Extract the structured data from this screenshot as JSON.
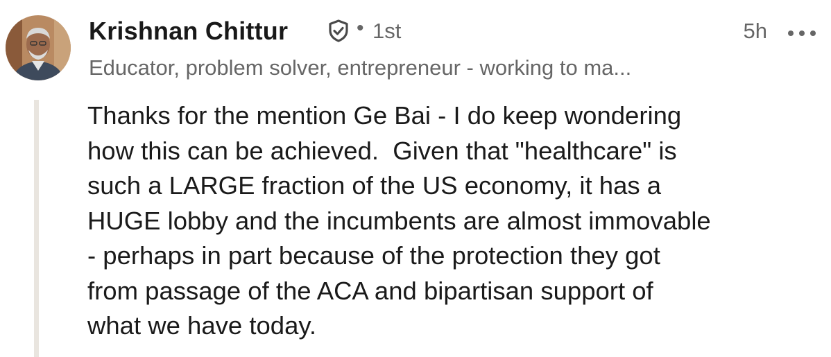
{
  "author": {
    "name": "Krishnan Chittur",
    "degree": "1st",
    "headline": "Educator, problem solver, entrepreneur - working to ma..."
  },
  "meta": {
    "separator": "•",
    "time": "5h"
  },
  "comment": {
    "lines": [
      "Thanks for the mention Ge Bai - I do keep wondering",
      "how this can be achieved.  Given that \"healthcare\" is",
      "such a LARGE fraction of the US economy, it has a",
      "HUGE lobby and the incumbents are almost immovable",
      "- perhaps in part because of the protection they got",
      "from passage of the ACA and bipartisan support of",
      "what we have today."
    ]
  },
  "icons": {
    "verified": "shield-check-icon",
    "more": "more-horizontal-icon"
  },
  "colors": {
    "text_primary": "#1a1a1a",
    "text_secondary": "#666666",
    "thread_line": "#e9e5df"
  }
}
